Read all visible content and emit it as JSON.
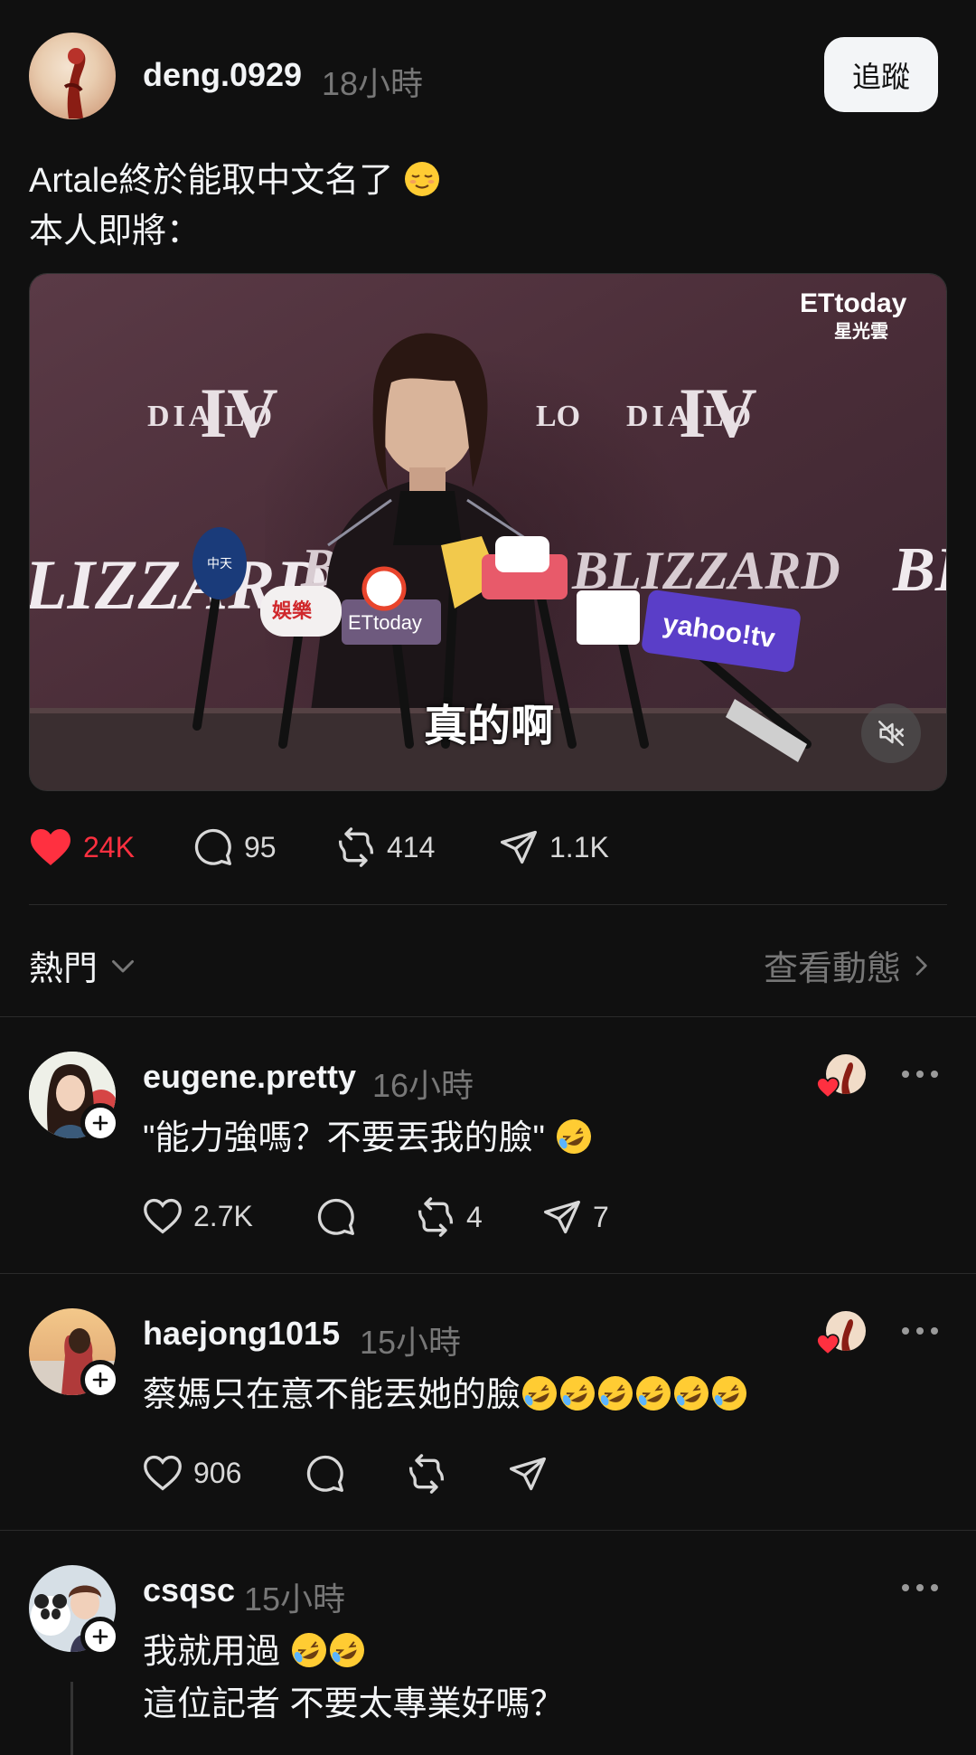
{
  "post": {
    "username": "deng.0929",
    "time": "18小時",
    "follow_label": "追蹤",
    "text_line1": "Artale終於能取中文名了",
    "text_line2": "本人即將："
  },
  "video": {
    "watermark_brand": "ETtoday",
    "watermark_sub": "星光雲",
    "caption": "真的啊",
    "backdrop_logo_1": "DIABLO",
    "backdrop_logo_2": "BLIZZARD",
    "muted": true
  },
  "post_actions": {
    "likes": "24K",
    "comments": "95",
    "reposts": "414",
    "shares": "1.1K",
    "liked": true
  },
  "replies_header": {
    "sort_label": "熱門",
    "activity_link": "查看動態"
  },
  "replies": [
    {
      "username": "eugene.pretty",
      "time": "16小時",
      "text": "\"能力強嗎？不要丟我的臉\"",
      "likes": "2.7K",
      "comments": "",
      "reposts": "4",
      "shares": "7"
    },
    {
      "username": "haejong1015",
      "time": "15小時",
      "text": "蔡媽只在意不能丟她的臉",
      "likes": "906",
      "comments": "",
      "reposts": "",
      "shares": ""
    },
    {
      "username": "csqsc",
      "time": "15小時",
      "text_line1": "我就用過 ",
      "text_line2": "這位記者 不要太專業好嗎？"
    }
  ],
  "colors": {
    "background": "#101010",
    "like_red": "#ff3040",
    "muted_text": "#777777"
  }
}
